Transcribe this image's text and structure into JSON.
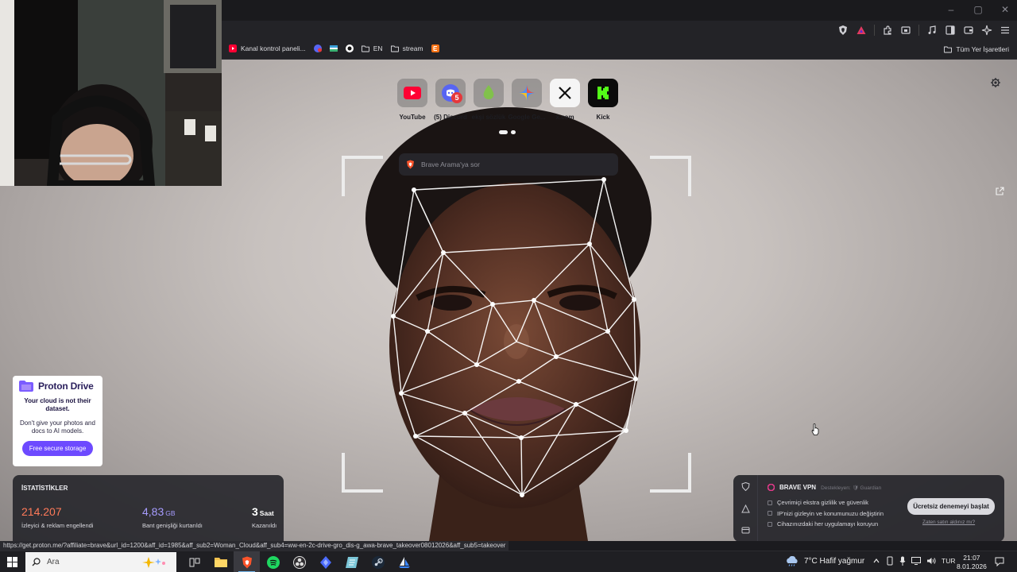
{
  "window": {
    "minimize": "‒",
    "maximize": "▢",
    "close": "✕"
  },
  "bookmarks": {
    "items": [
      {
        "label": "Kanal kontrol paneli...",
        "favicon": "youtube-studio-icon",
        "color": "#ff0033"
      },
      {
        "label": "",
        "favicon": "discord-badge-icon",
        "color": "#5865f2"
      },
      {
        "label": "",
        "favicon": "flag-icon",
        "color": "#3aa0d8"
      },
      {
        "label": "",
        "favicon": "circle-icon",
        "color": "#ffffff"
      },
      {
        "label": "EN",
        "favicon": "folder-icon",
        "color": "#dcdce0"
      },
      {
        "label": "stream",
        "favicon": "folder-icon",
        "color": "#dcdce0"
      },
      {
        "label": "",
        "favicon": "e-icon",
        "color": "#f97316"
      }
    ],
    "all_bookmarks": "Tüm Yer İşaretleri"
  },
  "top_sites": [
    {
      "label": "YouTube",
      "icon": "youtube-icon"
    },
    {
      "label": "(5) Discord",
      "icon": "discord-icon"
    },
    {
      "label": "ekşi sözlük",
      "icon": "eksi-icon"
    },
    {
      "label": "Google Ge...",
      "icon": "gemini-icon"
    },
    {
      "label": "x.com",
      "icon": "x-icon"
    },
    {
      "label": "Kick",
      "icon": "kick-icon"
    }
  ],
  "discord_badge": "5",
  "search": {
    "placeholder": "Brave Arama'ya sor"
  },
  "proton": {
    "brand": "Proton Drive",
    "headline": "Your cloud is not their dataset.",
    "body": "Don't give your photos and docs to AI models.",
    "cta": "Free secure storage"
  },
  "stats": {
    "title": "İSTATİSTİKLER",
    "items": [
      {
        "value": "214.207",
        "unit": "",
        "label": "İzleyici & reklam engellendi",
        "color": "#ff7a59"
      },
      {
        "value": "4,83",
        "unit": "GB",
        "label": "Bant genişliği kurtarıldı",
        "color": "#a79cff"
      },
      {
        "value": "3",
        "unit": "Saat",
        "label": "Kazanıldı",
        "color": "#ffffff"
      }
    ]
  },
  "vpn": {
    "title": "BRAVE VPN",
    "sponsor": "Destekleyen: 🛡 Guardian",
    "features": [
      "Çevrimiçi ekstra gizlilik ve güvenlik",
      "IP'nizi gizleyin ve konumunuzu değiştirin",
      "Cihazınızdaki her uygulamayı koruyun"
    ],
    "cta": "Ücretsiz denemeyi başlat",
    "link": "Zaten satın aldınız mı?"
  },
  "status_url": "https://get.proton.me/?affiliate=brave&url_id=1200&aff_id=1985&aff_sub2=Woman_Cloud&aff_sub4=ww-en-2c-drive-gro_dis-g_awa-brave_takeover08012026&aff_sub5=takeover",
  "taskbar": {
    "search_placeholder": "Ara",
    "weather": "7°C  Hafif yağmur",
    "lang": "TUR",
    "time": "21:07",
    "date": "8.01.2026"
  },
  "colors": {
    "accent": "#6d4aff",
    "brave": "#fb542b"
  }
}
